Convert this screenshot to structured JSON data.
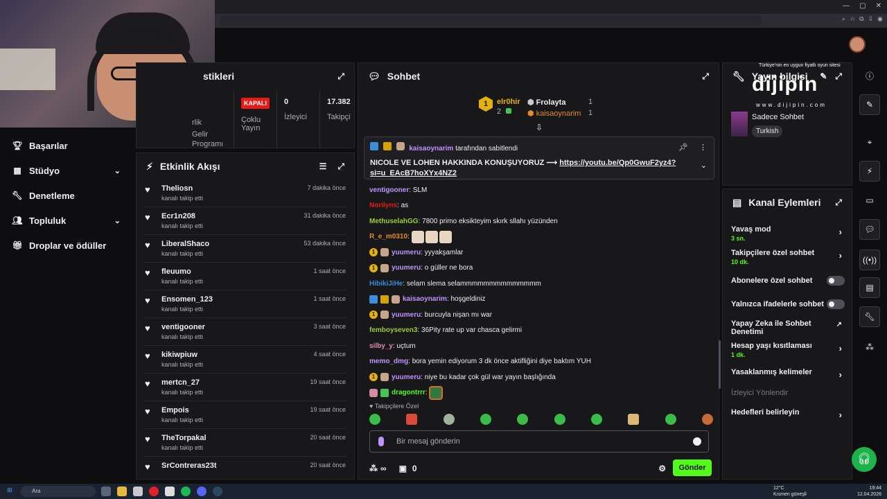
{
  "nav": {
    "items": [
      {
        "label": "Başarılar",
        "icon": "trophy-icon"
      },
      {
        "label": "Stüdyo",
        "icon": "studio-icon",
        "chevron": true
      },
      {
        "label": "Denetleme",
        "icon": "wrench-icon"
      },
      {
        "label": "Topluluk",
        "icon": "community-icon",
        "chevron": true
      },
      {
        "label": "Droplar ve ödüller",
        "icon": "gift-icon"
      }
    ]
  },
  "stats": {
    "title": "stikleri",
    "partial_left": "rlik",
    "program": [
      "Gelir",
      "Programı"
    ],
    "cells": [
      {
        "value": "KAPALI",
        "label1": "Çoklu",
        "label2": "Yayın",
        "badge": true
      },
      {
        "value": "0",
        "label1": "İzleyici",
        "label2": ""
      },
      {
        "value": "17.382",
        "label1": "Takipçi",
        "label2": ""
      }
    ]
  },
  "activity": {
    "title": "Etkinlik Akışı",
    "items": [
      {
        "name": "Theliosn",
        "sub": "kanalı takip etti",
        "time": "7 dakika önce"
      },
      {
        "name": "Ecr1n208",
        "sub": "kanalı takip etti",
        "time": "31 dakika önce"
      },
      {
        "name": "LiberalShaco",
        "sub": "kanalı takip etti",
        "time": "53 dakika önce"
      },
      {
        "name": "fleuumo",
        "sub": "kanalı takip etti",
        "time": "1 saat önce"
      },
      {
        "name": "Ensomen_123",
        "sub": "kanalı takip etti",
        "time": "1 saat önce"
      },
      {
        "name": "ventigooner",
        "sub": "kanalı takip etti",
        "time": "3 saat önce"
      },
      {
        "name": "kikiwpiuw",
        "sub": "kanalı takip etti",
        "time": "4 saat önce"
      },
      {
        "name": "mertcn_27",
        "sub": "kanalı takip etti",
        "time": "19 saat önce"
      },
      {
        "name": "Empois",
        "sub": "kanalı takip etti",
        "time": "19 saat önce"
      },
      {
        "name": "TheTorpakal",
        "sub": "kanalı takip etti",
        "time": "20 saat önce"
      },
      {
        "name": "SrContreras23t",
        "sub": "",
        "time": "20 saat önce"
      }
    ]
  },
  "chat": {
    "title": "Sohbet",
    "leaderboard": {
      "first": {
        "rank": "1",
        "name": "elr0hir",
        "count": "2"
      },
      "second": {
        "name": "Frolayta",
        "count": "1"
      },
      "third": {
        "name": "kaisaoynarim",
        "count": "1"
      }
    },
    "pinned": {
      "by_user": "kaisaoynarim",
      "by_text": "tarafından sabitlendi",
      "msg_text": "NICOLE VE LOHEN HAKKINDA KONUŞUYORUZ ⟶",
      "link": "https://youtu.be/Qp0GwuF2yz4?si=u_EAcB7hoXYx4NZ2"
    },
    "messages": [
      {
        "user": "ventigooner",
        "color": "#bf94ff",
        "text": "SLM",
        "badges": []
      },
      {
        "user": "Norilyns",
        "color": "#e91916",
        "text": "as",
        "badges": []
      },
      {
        "user": "MethuselahGG",
        "color": "#9acd32",
        "text": "7800 primo eksikteyim skırk sllahı yüzünden",
        "badges": []
      },
      {
        "user": "R_e_m0310",
        "color": "#e58a2a",
        "text": "",
        "badges": [],
        "emotes": 3
      },
      {
        "user": "yuumeru",
        "color": "#bf94ff",
        "text": "yyyakşamlar",
        "badges": [
          "gold",
          "cat"
        ]
      },
      {
        "user": "yuumeru",
        "color": "#bf94ff",
        "text": "o güller ne bora",
        "badges": [
          "gold",
          "cat"
        ]
      },
      {
        "user": "HibikiJiHe",
        "color": "#3d8bd9",
        "text": "selam slema selammmmmmmmmmmmmm",
        "badges": []
      },
      {
        "user": "kaisaoynarim",
        "color": "#bf94ff",
        "text": "hoşgeldiniz",
        "badges": [
          "blue",
          "crown",
          "cat"
        ]
      },
      {
        "user": "yuumeru",
        "color": "#bf94ff",
        "text": "burcuyla nişan mı war",
        "badges": [
          "gold",
          "cat"
        ]
      },
      {
        "user": "femboyseven3",
        "color": "#9acd32",
        "text": "36Pity rate up var chasca gelirmi",
        "badges": []
      },
      {
        "user": "silby_y",
        "color": "#e58ab0",
        "text": "uçtum",
        "badges": []
      },
      {
        "user": "memo_dmg",
        "color": "#bf94ff",
        "text": "bora yemin ediyorum 3 dk önce aktifliğini diye baktım YUH",
        "badges": []
      },
      {
        "user": "yuumeru",
        "color": "#bf94ff",
        "text": "niye bu kadar çok gül war yayın başlığında",
        "badges": [
          "gold",
          "cat"
        ]
      },
      {
        "user": "dragontrrr",
        "color": "#53fc18",
        "text": "",
        "badges": [
          "pink",
          "green"
        ],
        "emotes": 1
      }
    ],
    "followers_only": "Takipçilere Özel",
    "input_placeholder": "Bir mesaj gönderin",
    "infinity": "∞",
    "count": "0",
    "send": "Gönder"
  },
  "info": {
    "title": "Yayın bilgisi",
    "logo_top": "Türkiye'nin en uygun fiyatlı oyun sitesi",
    "logo": "dijipin",
    "logo_url": "www.dijipin.com",
    "category": "Sadece Sohbet",
    "tag": "Turkish"
  },
  "actions": {
    "title": "Kanal Eylemleri",
    "rows": [
      {
        "label": "Yavaş mod",
        "value": "3 sn.",
        "kind": "arrow"
      },
      {
        "label": "Takipçilere özel sohbet",
        "value": "10 dk.",
        "kind": "arrow"
      },
      {
        "label": "Abonelere özel sohbet",
        "value": "",
        "kind": "toggle"
      },
      {
        "label": "Yalnızca ifadelerle sohbet",
        "value": "",
        "kind": "toggle"
      },
      {
        "label": "Yapay Zeka ile Sohbet Denetimi",
        "value": "",
        "kind": "external"
      },
      {
        "label": "Hesap yaşı kısıtlaması",
        "value": "1 dk.",
        "kind": "arrow"
      },
      {
        "label": "Yasaklanmış kelimeler",
        "value": "",
        "kind": "arrow"
      },
      {
        "label": "İzleyici Yönlendir",
        "value": "",
        "kind": "disabled"
      },
      {
        "label": "Hedefleri belirleyin",
        "value": "",
        "kind": "arrow"
      }
    ]
  },
  "taskbar": {
    "search": "Ara",
    "weather_temp": "12°C",
    "weather_desc": "Kısmen güneşli",
    "time": "19:44",
    "date": "12.04.2026"
  },
  "colors": {
    "accent": "#53fc18",
    "panel": "#18181b",
    "bg": "#0e0e10"
  }
}
